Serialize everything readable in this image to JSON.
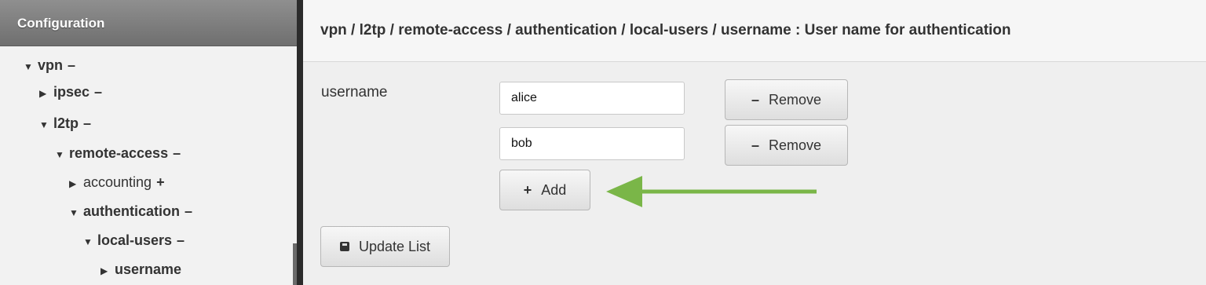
{
  "sidebar": {
    "header": "Configuration",
    "tree": [
      {
        "label": "vpn",
        "action": "–"
      },
      {
        "label": "ipsec",
        "action": "–"
      },
      {
        "label": "l2tp",
        "action": "–"
      },
      {
        "label": "remote-access",
        "action": "–"
      },
      {
        "label": "accounting",
        "action": "+"
      },
      {
        "label": "authentication",
        "action": "–"
      },
      {
        "label": "local-users",
        "action": "–"
      },
      {
        "label": "username"
      }
    ]
  },
  "main": {
    "breadcrumb": "vpn / l2tp / remote-access / authentication / local-users / username : User name for authentication",
    "field_label": "username",
    "entries": [
      {
        "value": "alice",
        "remove_label": "Remove"
      },
      {
        "value": "bob",
        "remove_label": "Remove"
      }
    ],
    "add_label": "Add",
    "update_label": "Update List"
  },
  "colors": {
    "arrow": "#7ab648"
  },
  "icons": [
    "caret-down-icon",
    "caret-right-icon",
    "minus-icon",
    "plus-icon",
    "save-icon",
    "arrow-left-icon"
  ]
}
